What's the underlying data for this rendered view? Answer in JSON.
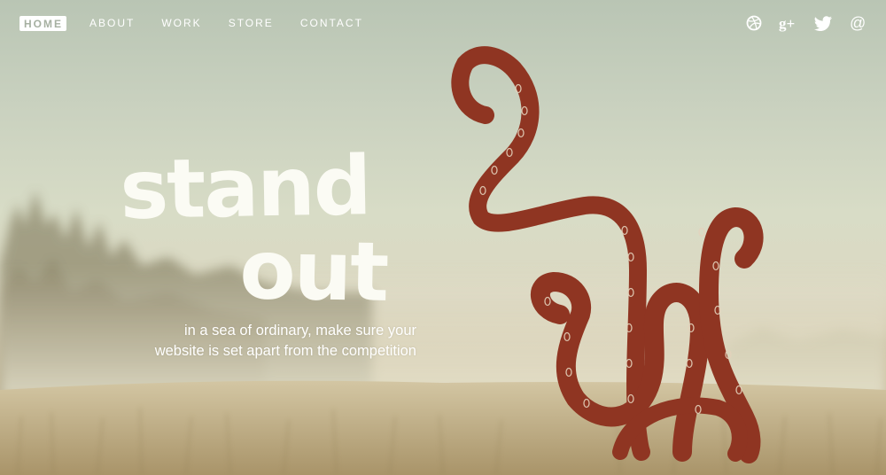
{
  "nav": {
    "items": [
      {
        "label": "HOME",
        "active": true
      },
      {
        "label": "ABOUT",
        "active": false
      },
      {
        "label": "WORK",
        "active": false
      },
      {
        "label": "STORE",
        "active": false
      },
      {
        "label": "CONTACT",
        "active": false
      }
    ]
  },
  "social": {
    "icons": [
      "dribbble-icon",
      "google-plus-icon",
      "twitter-icon",
      "at-sign-icon"
    ],
    "google_plus_label": "g+",
    "at_label": "@"
  },
  "hero": {
    "headline_line1": "stand",
    "headline_line2": "out",
    "tagline_line1": "in a sea of ordinary, make sure your",
    "tagline_line2": "website is set apart from the competition"
  },
  "colors": {
    "sky_top": "#b9c5b4",
    "mist": "#dcd8c2",
    "grass": "#bba87f",
    "tentacle": "#8f3522",
    "text": "#ffffff"
  }
}
